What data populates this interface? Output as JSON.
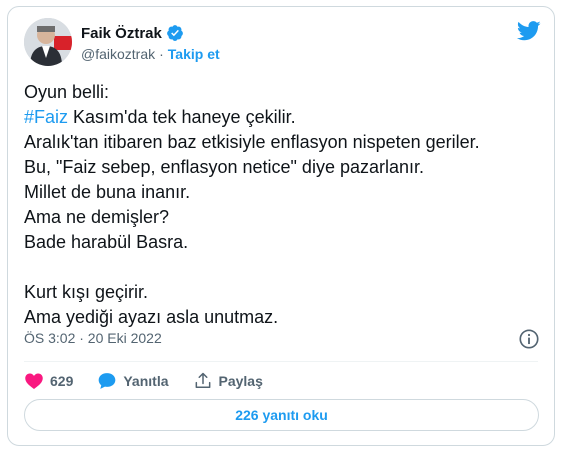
{
  "author": {
    "name": "Faik Öztrak",
    "handle": "@faikoztrak",
    "separator": "·",
    "follow_label": "Takip et"
  },
  "tweet": {
    "lines": [
      "Oyun belli:",
      "Kasım'da tek haneye çekilir.",
      "Aralık'tan itibaren baz etkisiyle enflasyon nispeten geriler.",
      "Bu, \"Faiz sebep, enflasyon netice\" diye pazarlanır.",
      "Millet de buna inanır.",
      "Ama ne demişler?",
      "Bade harabül Basra.",
      "Kurt kışı geçirir.",
      "Ama yediği ayazı asla unutmaz."
    ],
    "hashtag": "#Faiz",
    "timestamp": "ÖS 3:02 · 20 Eki 2022"
  },
  "actions": {
    "likes": "629",
    "reply_label": "Yanıtla",
    "share_label": "Paylaş"
  },
  "read_replies_label": "226 yanıtı oku",
  "colors": {
    "accent": "#1d9bf0",
    "like": "#f91880",
    "text": "#0f1419",
    "muted": "#536471",
    "border": "#cfd9de"
  },
  "icons": [
    "verified-badge-icon",
    "twitter-bird-icon",
    "info-icon",
    "heart-icon",
    "reply-bubble-icon",
    "share-icon"
  ]
}
